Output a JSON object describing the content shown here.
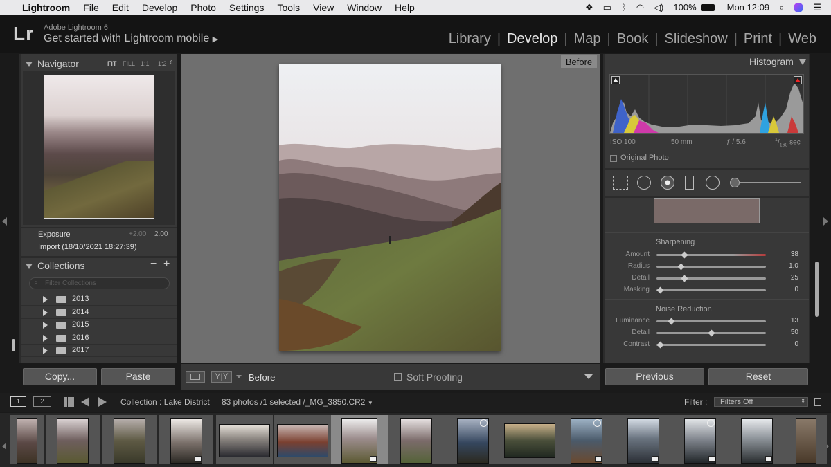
{
  "menubar": {
    "app": "Lightroom",
    "items": [
      "File",
      "Edit",
      "Develop",
      "Photo",
      "Settings",
      "Tools",
      "View",
      "Window",
      "Help"
    ],
    "battery": "100%",
    "clock": "Mon 12:09"
  },
  "header": {
    "app_name": "Adobe Lightroom 6",
    "get_started": "Get started with Lightroom mobile",
    "modules": [
      "Library",
      "Develop",
      "Map",
      "Book",
      "Slideshow",
      "Print",
      "Web"
    ],
    "active_module": "Develop"
  },
  "navigator": {
    "title": "Navigator",
    "zoom": [
      "FIT",
      "FILL",
      "1:1",
      "1:2"
    ]
  },
  "history": {
    "items": [
      {
        "label": "Exposure",
        "from": "+2.00",
        "to": "2.00"
      },
      {
        "label": "Import (18/10/2021 18:27:39)"
      }
    ]
  },
  "collections": {
    "title": "Collections",
    "filter_placeholder": "Filter Collections",
    "items": [
      "2013",
      "2014",
      "2015",
      "2016",
      "2017"
    ]
  },
  "left_buttons": {
    "copy": "Copy...",
    "paste": "Paste"
  },
  "view": {
    "before_badge": "Before",
    "toolbar_before": "Before",
    "soft_proofing": "Soft Proofing",
    "yy_left": "Y",
    "yy_right": "Y"
  },
  "histogram": {
    "title": "Histogram",
    "iso": "ISO 100",
    "focal": "50 mm",
    "aperture": "ƒ / 5.6",
    "shutter_num": "1",
    "shutter_den": "160",
    "shutter_unit": "sec",
    "original_photo": "Original Photo"
  },
  "detail": {
    "sharpening_title": "Sharpening",
    "sharpening": [
      {
        "label": "Amount",
        "value": "38",
        "frac": 0.25
      },
      {
        "label": "Radius",
        "value": "1.0",
        "frac": 0.22
      },
      {
        "label": "Detail",
        "value": "25",
        "frac": 0.25
      },
      {
        "label": "Masking",
        "value": "0",
        "frac": 0.03
      }
    ],
    "noise_title": "Noise Reduction",
    "noise": [
      {
        "label": "Luminance",
        "value": "13",
        "frac": 0.13
      },
      {
        "label": "Detail",
        "value": "50",
        "frac": 0.5
      },
      {
        "label": "Contrast",
        "value": "0",
        "frac": 0.03
      }
    ]
  },
  "right_buttons": {
    "previous": "Previous",
    "reset": "Reset"
  },
  "filmstrip_bar": {
    "screen1": "1",
    "screen2": "2",
    "collection": "Collection : Lake District",
    "count": "83 photos /1 selected /_MG_3850.CR2",
    "filter_label": "Filter :",
    "filter_value": "Filters Off"
  },
  "colors": {
    "accent": "#e6e6e6",
    "panel": "#383838",
    "background": "#1a1a1a"
  }
}
